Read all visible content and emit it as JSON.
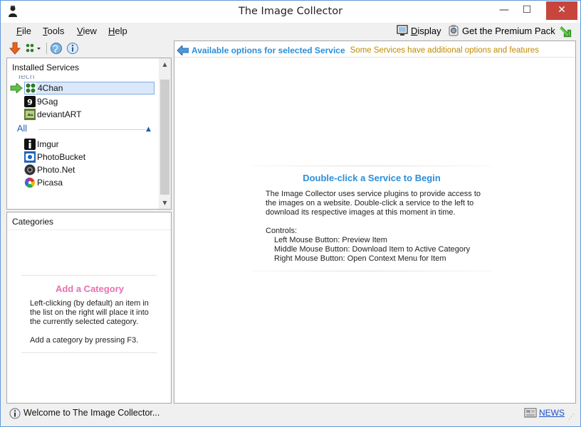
{
  "window": {
    "title": "The Image Collector",
    "controls": {
      "minimize": "—",
      "maximize": "☐",
      "close": "✕"
    }
  },
  "menu": {
    "items": [
      {
        "label": "File",
        "key": "F",
        "rest": "ile"
      },
      {
        "label": "Tools",
        "key": "T",
        "rest": "ools"
      },
      {
        "label": "View",
        "key": "V",
        "rest": "iew"
      },
      {
        "label": "Help",
        "key": "H",
        "rest": "elp"
      }
    ],
    "display": {
      "key": "D",
      "rest": "isplay"
    },
    "premium": "Get the Premium Pack"
  },
  "services": {
    "header": "Installed Services",
    "cut_group": "Tech",
    "items": [
      {
        "label": "4Chan",
        "icon": "4chan-icon",
        "color": "#2c7a2c"
      },
      {
        "label": "9Gag",
        "icon": "9gag-icon",
        "color": "#111111"
      },
      {
        "label": "deviantART",
        "icon": "deviantart-icon",
        "color": "#5d7a36"
      }
    ],
    "group_all": {
      "label": "All",
      "toggle": "▲",
      "items": [
        {
          "label": "Imgur",
          "icon": "imgur-icon",
          "color": "#111111"
        },
        {
          "label": "PhotoBucket",
          "icon": "photobucket-icon",
          "color": "#1f66b8"
        },
        {
          "label": "Photo.Net",
          "icon": "photonet-icon",
          "color": "#333333"
        },
        {
          "label": "Picasa",
          "icon": "picasa-icon",
          "color": "#c33"
        }
      ]
    }
  },
  "categories": {
    "header": "Categories",
    "title": "Add a Category",
    "text": "Left-clicking (by default) an item in the list on the right will place it into the currently selected category.",
    "text2": "Add a category by pressing F3."
  },
  "main": {
    "header": "Available options for selected Service",
    "subheader": "Some Services have additional options and features",
    "center_title": "Double-click a Service to Begin",
    "center_body": "The Image Collector uses service plugins to provide access to the images on a website. Double-click a service to the left to download its respective images at this moment in time.",
    "controls_label": "Controls:",
    "controls": [
      "Left Mouse Button: Preview Item",
      "Middle Mouse Button: Download Item to Active Category",
      "Right Mouse Button: Open Context Menu for Item"
    ]
  },
  "status": {
    "text": "Welcome to The Image Collector...",
    "news": "NEWS"
  },
  "colors": {
    "accent_blue": "#2b8ed8",
    "category_pink": "#ea6fb1",
    "subheader_gold": "#c08a00",
    "close_red": "#c7463c"
  }
}
